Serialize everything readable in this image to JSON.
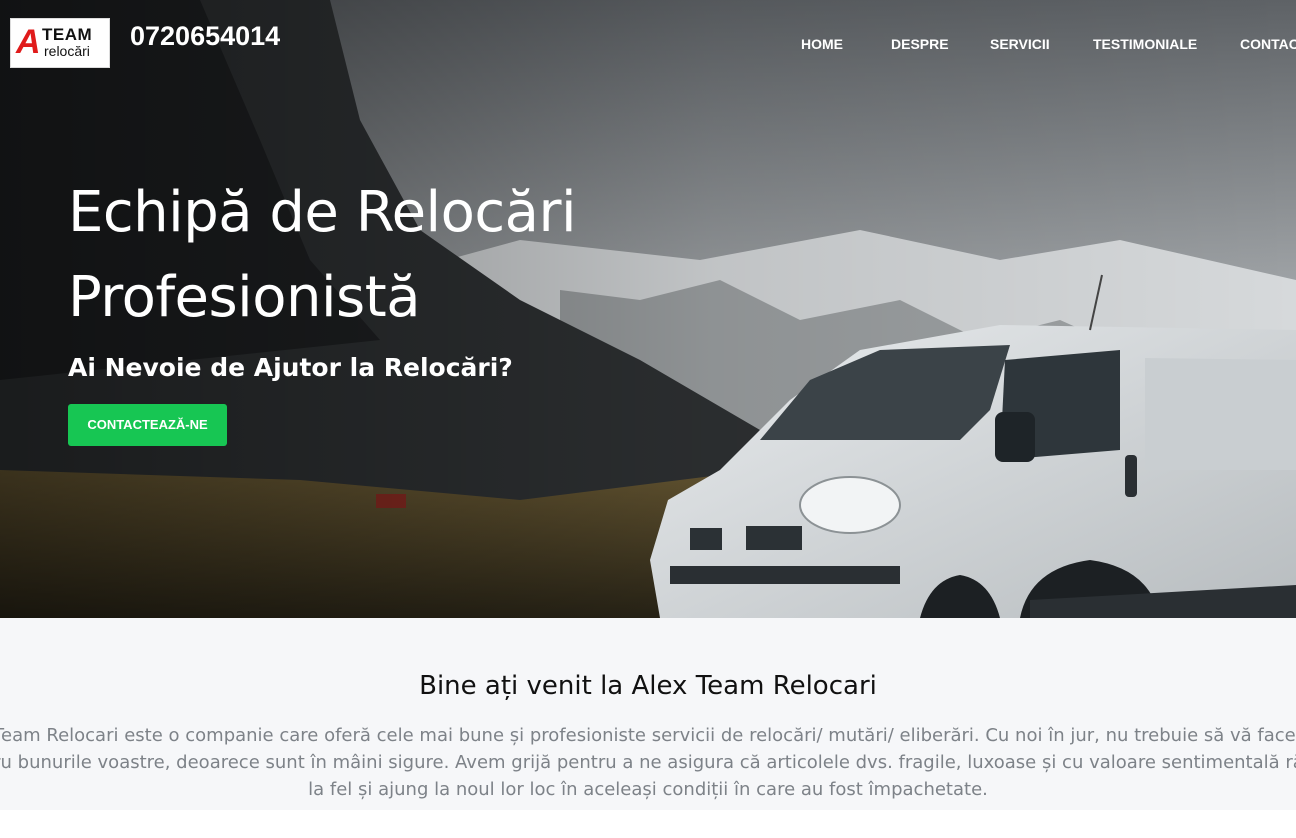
{
  "header": {
    "logo": {
      "letter": "A",
      "word1": "TEAM",
      "word2": "relocări"
    },
    "phone": "0720654014",
    "nav": [
      {
        "label": "HOME"
      },
      {
        "label": "DESPRE"
      },
      {
        "label": "SERVICII"
      },
      {
        "label": "TESTIMONIALE"
      },
      {
        "label": "CONTACT"
      }
    ]
  },
  "hero": {
    "title_line1": "Echipă de Relocări",
    "title_line2": "Profesionistă",
    "subtitle": "Ai Nevoie de Ajutor la Relocări?",
    "cta_label": "CONTACTEAZĂ-NE"
  },
  "about": {
    "title": "Bine ați venit la Alex Team Relocari",
    "text": "Alex Team Relocari este o companie care oferă cele mai bune și profesioniste servicii de relocări/ mutări/ eliberări. Cu noi în jur, nu trebuie să vă faceți griji pentru bunurile voastre, deoarece sunt în mâini sigure. Avem grijă pentru a ne asigura că articolele dvs. fragile, luxoase și cu valoare sentimentală rămân la fel și ajung la noul lor loc în aceleași condiții în care au fost împachetate."
  },
  "colors": {
    "accent_green": "#17c653",
    "logo_red": "#e01b1b",
    "about_bg": "#f6f7f9",
    "muted_text": "#7d8288"
  }
}
